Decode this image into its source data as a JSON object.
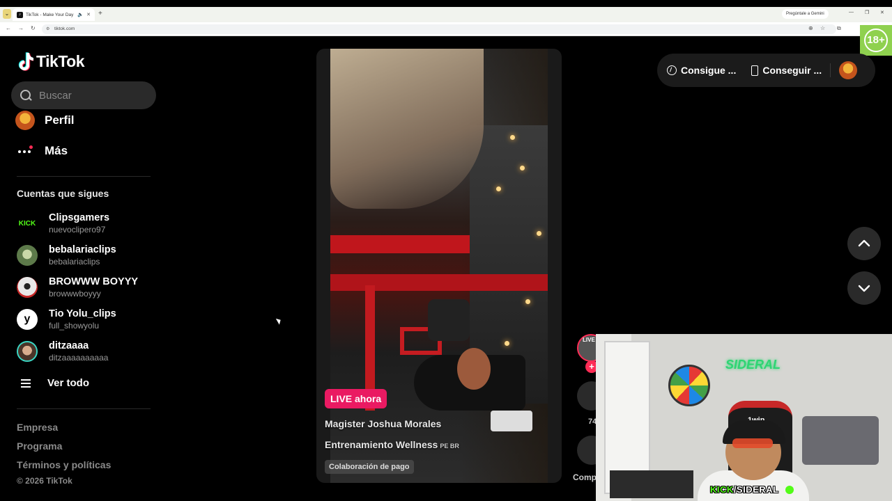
{
  "browser": {
    "tab_title": "TikTok - Make Your Day",
    "new_tab": "+",
    "gemini": "Pregúntale a Gemini",
    "url": "tiktok.com"
  },
  "age_badge": "18+",
  "logo": "TikTok",
  "search": {
    "placeholder": "Buscar"
  },
  "menu": [
    {
      "label": "Perfil",
      "icon": "profile-avatar"
    },
    {
      "label": "Más",
      "icon": "more-dots-icon"
    }
  ],
  "following": {
    "title": "Cuentas que sigues",
    "accounts": [
      {
        "name": "Clipsgamers",
        "handle": "nuevoclipero97",
        "avatar_text": "KICK",
        "color": "#53fc18"
      },
      {
        "name": "bebalariaclips",
        "handle": "bebalariaclips",
        "avatar_text": "",
        "color": "#7a9a6a"
      },
      {
        "name": "BROWWW BOYYY",
        "handle": "browwwboyyy",
        "avatar_text": "",
        "color": "#d8d8d8"
      },
      {
        "name": "Tio Yolu_clips",
        "handle": "full_showyolu",
        "avatar_text": "y",
        "color": "#ffffff"
      },
      {
        "name": "ditzaaaa",
        "handle": "ditzaaaaaaaaaa",
        "avatar_text": "",
        "color": "#b88a70"
      }
    ],
    "see_all": "Ver todo"
  },
  "footer": {
    "links": [
      "Empresa",
      "Programa",
      "Términos y políticas"
    ],
    "copyright": "© 2026 TikTok"
  },
  "video": {
    "live_badge": "LIVE ahora",
    "title": "Magister Joshua Morales",
    "subtitle": "Entrenamiento Wellness",
    "subtitle_flags": "PE BR",
    "paid_label": "Colaboración de pago"
  },
  "top_actions": {
    "coins": "Consigue ...",
    "app": "Conseguir ..."
  },
  "side_actions": {
    "live_tag": "LIVE",
    "like_count": "74",
    "share_label": "Comp"
  },
  "webcam": {
    "neon": "SIDERAL",
    "chair_text": "1win",
    "overlay_prefix": "KICK",
    "overlay_name": "/SIDERAL"
  }
}
